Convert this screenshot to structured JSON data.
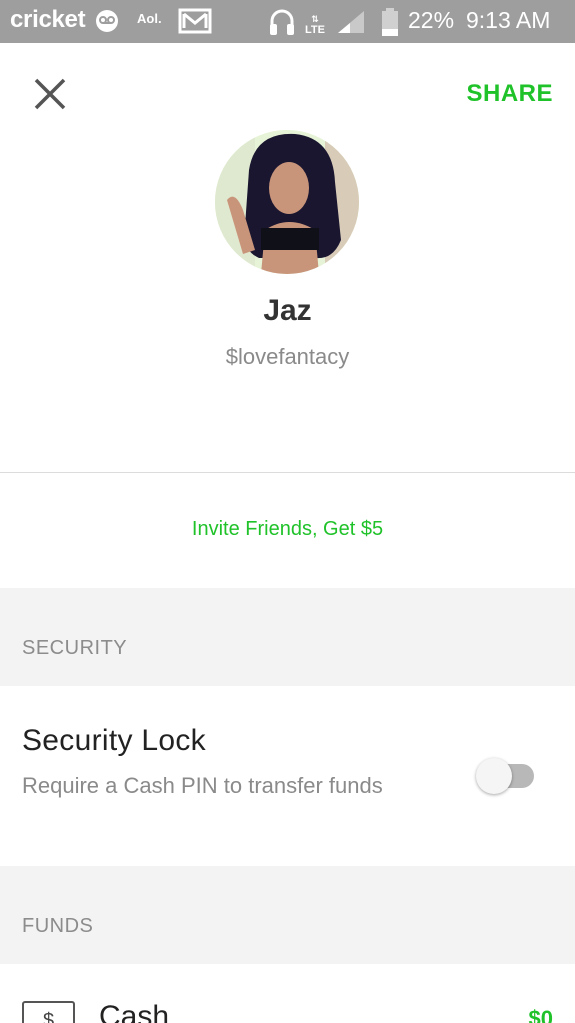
{
  "status_bar": {
    "carrier": "cricket",
    "aol_label": "Aol.",
    "network": "LTE",
    "battery": "22%",
    "time": "9:13 AM",
    "icons": [
      "voicemail-icon",
      "aol-icon",
      "gmail-icon",
      "headphones-icon",
      "signal-icon",
      "battery-icon"
    ]
  },
  "header": {
    "close_icon": "close-icon",
    "share_label": "SHARE"
  },
  "profile": {
    "name": "Jaz",
    "handle": "$lovefantacy"
  },
  "invite": {
    "label": "Invite Friends, Get $5"
  },
  "security": {
    "header": "SECURITY",
    "lock_title": "Security Lock",
    "lock_description": "Require a Cash PIN to transfer funds",
    "lock_enabled": false
  },
  "funds": {
    "header": "FUNDS",
    "cash_icon_symbol": "$",
    "cash_label": "Cash",
    "cash_value": "$0"
  },
  "colors": {
    "accent": "#20c22a",
    "status_bar": "#9e9e9e",
    "section_bg": "#f3f3f3",
    "muted_text": "#8a8a8a"
  }
}
